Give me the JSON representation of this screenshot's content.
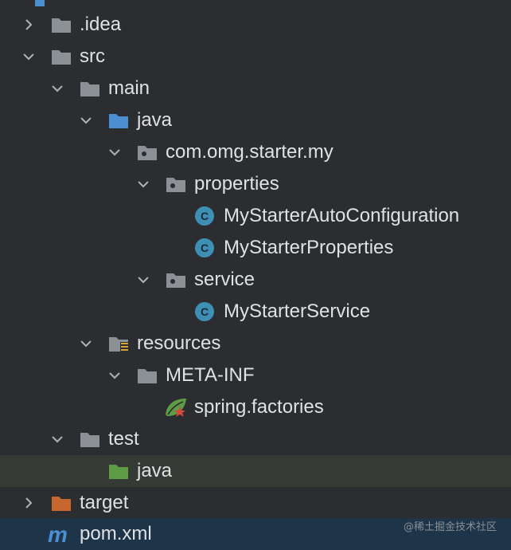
{
  "tree": {
    "rows": [
      {
        "label": ".idea",
        "icon": "folder-icon",
        "expanded": false
      },
      {
        "label": "src",
        "icon": "folder-icon",
        "expanded": true
      },
      {
        "label": "main",
        "icon": "folder-icon",
        "expanded": true
      },
      {
        "label": "java",
        "icon": "source-folder-icon",
        "expanded": true
      },
      {
        "label": "com.omg.starter.my",
        "icon": "package-icon",
        "expanded": true
      },
      {
        "label": "properties",
        "icon": "package-icon",
        "expanded": true
      },
      {
        "label": "MyStarterAutoConfiguration",
        "icon": "class-icon"
      },
      {
        "label": "MyStarterProperties",
        "icon": "class-icon"
      },
      {
        "label": "service",
        "icon": "package-icon",
        "expanded": true
      },
      {
        "label": "MyStarterService",
        "icon": "class-icon"
      },
      {
        "label": "resources",
        "icon": "resources-folder-icon",
        "expanded": true
      },
      {
        "label": "META-INF",
        "icon": "folder-icon",
        "expanded": true
      },
      {
        "label": "spring.factories",
        "icon": "spring-icon"
      },
      {
        "label": "test",
        "icon": "folder-icon",
        "expanded": true
      },
      {
        "label": "java",
        "icon": "test-source-folder-icon"
      },
      {
        "label": "target",
        "icon": "excluded-folder-icon",
        "expanded": false
      },
      {
        "label": "pom.xml",
        "icon": "maven-icon"
      }
    ]
  },
  "watermark": "@稀土掘金技术社区",
  "colors": {
    "background": "#2b2d30",
    "text": "#dfe1e5",
    "folder": "#8c9196",
    "source_folder": "#4b8fd1",
    "test_folder": "#5e9c46",
    "excluded_folder": "#c8662f",
    "class_badge": "#3f8fb5",
    "row_highlight": "#363a35",
    "selected_row": "#1e3448"
  }
}
